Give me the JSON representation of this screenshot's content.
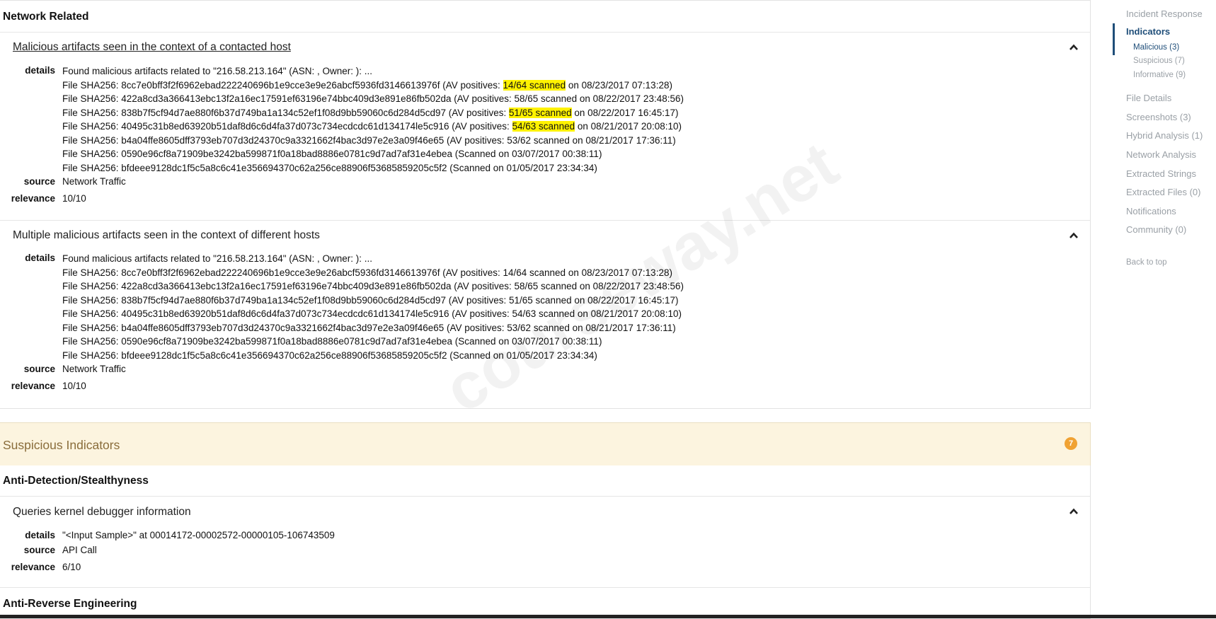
{
  "network": {
    "section_title": "Network Related",
    "indicators": [
      {
        "title": "Malicious artifacts seen in the context of a contacted host",
        "details_label": "details",
        "intro": "Found malicious artifacts related to \"216.58.213.164\" (ASN: , Owner: ): ...",
        "files": [
          {
            "pre": "File SHA256: 8cc7e0bff3f2f6962ebad222240696b1e9cce3e9e26abcf5936fd3146613976f (AV positives: ",
            "hl": "14/64 scanned",
            "post": " on 08/23/2017 07:13:28)"
          },
          {
            "pre": "File SHA256: 422a8cd3a366413ebc13f2a16ec17591ef63196e74bbc409d3e891e86fb502da (AV positives: 58/65 scanned on 08/22/2017 23:48:56)",
            "hl": "",
            "post": ""
          },
          {
            "pre": "File SHA256: 838b7f5cf94d7ae880f6b37d749ba1a134c52ef1f08d9bb59060c6d284d5cd97 (AV positives: ",
            "hl": "51/65 scanned",
            "post": " on 08/22/2017 16:45:17)"
          },
          {
            "pre": "File SHA256: 40495c31b8ed63920b51daf8d6c6d4fa37d073c734ecdcdc61d134174le5c916 (AV positives: ",
            "hl": "54/63 scanned",
            "post": " on 08/21/2017 20:08:10)"
          },
          {
            "pre": "File SHA256: b4a04ffe8605dff3793eb707d3d24370c9a3321662f4bac3d97e2e3a09f46e65 (AV positives: 53/62 scanned on 08/21/2017 17:36:11)",
            "hl": "",
            "post": ""
          },
          {
            "pre": "File SHA256: 0590e96cf8a71909be3242ba599871f0a18bad8886e0781c9d7ad7af31e4ebea (Scanned on 03/07/2017 00:38:11)",
            "hl": "",
            "post": ""
          },
          {
            "pre": "File SHA256: bfdeee9128dc1f5c5a8c6c41e356694370c62a256ce88906f53685859205c5f2 (Scanned on 01/05/2017 23:34:34)",
            "hl": "",
            "post": ""
          }
        ],
        "source_label": "source",
        "source": "Network Traffic",
        "relevance_label": "relevance",
        "relevance": "10/10"
      },
      {
        "title": "Multiple malicious artifacts seen in the context of different hosts",
        "details_label": "details",
        "intro": "Found malicious artifacts related to \"216.58.213.164\" (ASN: , Owner: ): ...",
        "files": [
          "File SHA256: 8cc7e0bff3f2f6962ebad222240696b1e9cce3e9e26abcf5936fd3146613976f (AV positives: 14/64 scanned on 08/23/2017 07:13:28)",
          "File SHA256: 422a8cd3a366413ebc13f2a16ec17591ef63196e74bbc409d3e891e86fb502da (AV positives: 58/65 scanned on 08/22/2017 23:48:56)",
          "File SHA256: 838b7f5cf94d7ae880f6b37d749ba1a134c52ef1f08d9bb59060c6d284d5cd97 (AV positives: 51/65 scanned on 08/22/2017 16:45:17)",
          "File SHA256: 40495c31b8ed63920b51daf8d6c6d4fa37d073c734ecdcdc61d134174le5c916 (AV positives: 54/63 scanned on 08/21/2017 20:08:10)",
          "File SHA256: b4a04ffe8605dff3793eb707d3d24370c9a3321662f4bac3d97e2e3a09f46e65 (AV positives: 53/62 scanned on 08/21/2017 17:36:11)",
          "File SHA256: 0590e96cf8a71909be3242ba599871f0a18bad8886e0781c9d7ad7af31e4ebea (Scanned on 03/07/2017 00:38:11)",
          "File SHA256: bfdeee9128dc1f5c5a8c6c41e356694370c62a256ce88906f53685859205c5f2 (Scanned on 01/05/2017 23:34:34)"
        ],
        "source_label": "source",
        "source": "Network Traffic",
        "relevance_label": "relevance",
        "relevance": "10/10"
      }
    ]
  },
  "suspicious": {
    "title": "Suspicious Indicators",
    "count": "7",
    "accent": "#f0a233",
    "categories": [
      {
        "title": "Anti-Detection/Stealthyness",
        "indicator": {
          "title": "Queries kernel debugger information",
          "details_label": "details",
          "details": "\"<Input Sample>\" at 00014172-00002572-00000105-106743509",
          "source_label": "source",
          "source": "API Call",
          "relevance_label": "relevance",
          "relevance": "6/10"
        }
      },
      {
        "title": "Anti-Reverse Engineering"
      }
    ]
  },
  "sidebar": {
    "items": [
      "Incident Response",
      "Indicators",
      "Malicious (3)",
      "Suspicious (7)",
      "Informative (9)",
      "File Details",
      "Screenshots (3)",
      "Hybrid Analysis (1)",
      "Network Analysis",
      "Extracted Strings",
      "Extracted Files (0)",
      "Notifications",
      "Community (0)",
      "Back to top"
    ],
    "active_color": "#1f4e79"
  },
  "watermark": "courseway.net"
}
